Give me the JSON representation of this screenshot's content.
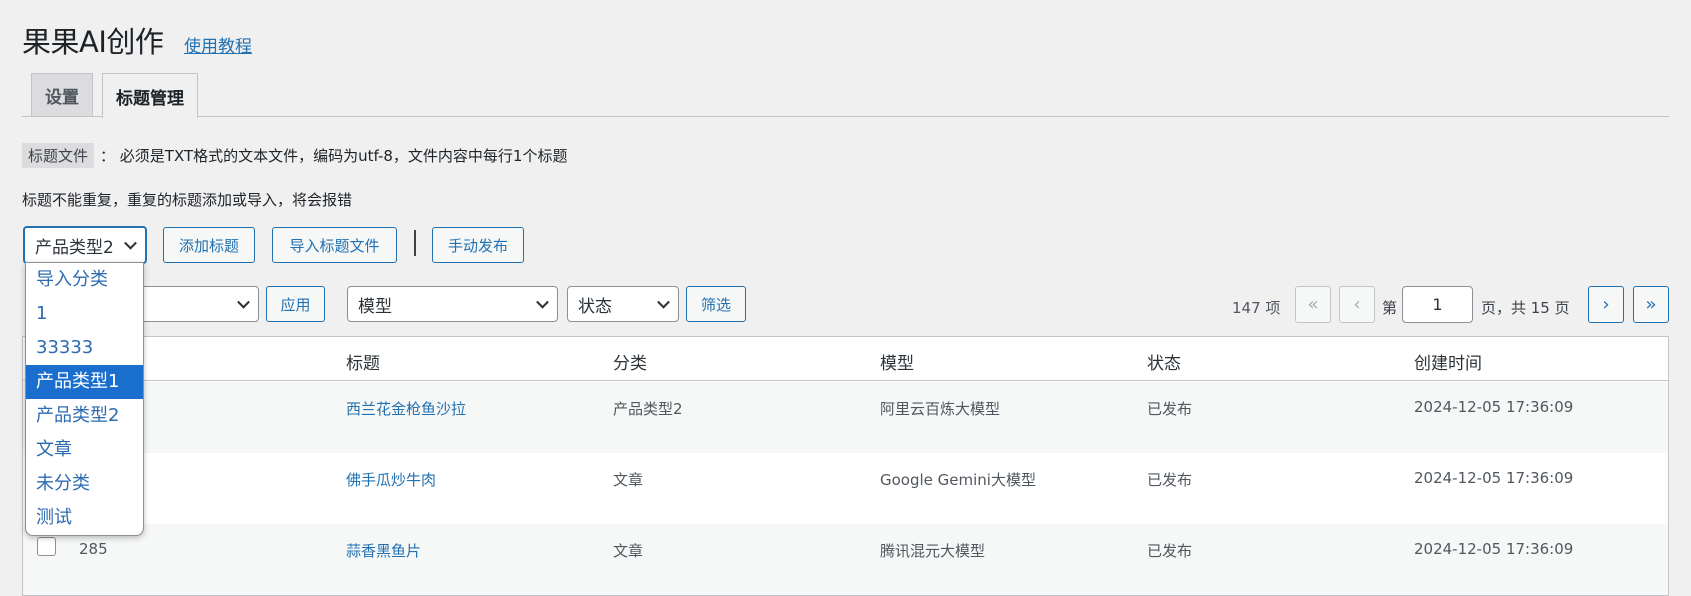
{
  "header": {
    "title": "果果AI创作",
    "tutorial_link": "使用教程"
  },
  "tabs": [
    {
      "label": "设置"
    },
    {
      "label": "标题管理"
    }
  ],
  "notes": {
    "file_label": "标题文件",
    "file_desc": "：  必须是TXT格式的文本文件，编码为utf-8，文件内容中每行1个标题",
    "no_dup": "标题不能重复，重复的标题添加或导入，将会报错"
  },
  "toolbar": {
    "category_select": "产品类型2",
    "add_title": "添加标题",
    "import_file": "导入标题文件",
    "manual_publish": "手动发布"
  },
  "dropdown": {
    "options": [
      "导入分类",
      "1",
      "33333",
      "产品类型1",
      "产品类型2",
      "文章",
      "未分类",
      "测试"
    ],
    "highlighted_index": 3
  },
  "filters": {
    "apply": "应用",
    "model": "模型",
    "status": "状态",
    "filter": "筛选"
  },
  "pagination": {
    "count": "147 项",
    "first": "«",
    "prev": "‹",
    "page_prefix": "第",
    "current": "1",
    "page_suffix": "页，共 15 页",
    "next": "›",
    "last": "»"
  },
  "table": {
    "columns": [
      "标题",
      "分类",
      "模型",
      "状态",
      "创建时间"
    ],
    "rows": [
      {
        "id": "",
        "title": "西兰花金枪鱼沙拉",
        "category": "产品类型2",
        "model": "阿里云百炼大模型",
        "status": "已发布",
        "created": "2024-12-05 17:36:09"
      },
      {
        "id": "",
        "title": "佛手瓜炒牛肉",
        "category": "文章",
        "model": "Google Gemini大模型",
        "status": "已发布",
        "created": "2024-12-05 17:36:09"
      },
      {
        "id": "285",
        "title": "蒜香黑鱼片",
        "category": "文章",
        "model": "腾讯混元大模型",
        "status": "已发布",
        "created": "2024-12-05 17:36:09"
      }
    ]
  }
}
